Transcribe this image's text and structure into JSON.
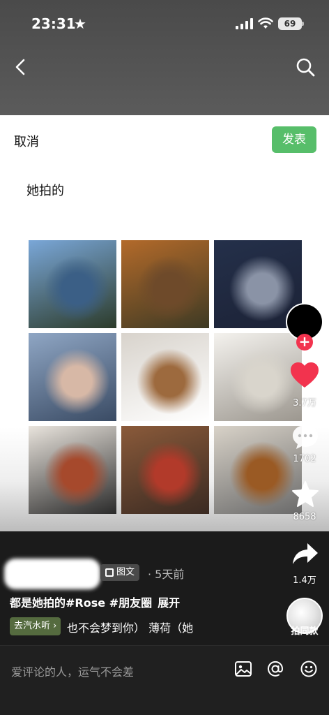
{
  "status_bar": {
    "time": "23:31",
    "battery": "69"
  },
  "editor": {
    "cancel_label": "取消",
    "publish_label": "发表",
    "post_text": "她拍的"
  },
  "photos": [
    {
      "name": "photo-ocean-view",
      "colors": [
        "#7aa7d8",
        "#3b5f86",
        "#2c3b2a"
      ]
    },
    {
      "name": "photo-autumn-path",
      "colors": [
        "#b36a2a",
        "#6e4a2a",
        "#3e3a24"
      ]
    },
    {
      "name": "photo-cloudy-sky",
      "colors": [
        "#24304a",
        "#8a93a6",
        "#1c2236"
      ]
    },
    {
      "name": "photo-hand-ring",
      "colors": [
        "#8fa6c4",
        "#d7b8a6",
        "#3a4b64"
      ]
    },
    {
      "name": "photo-puppy",
      "colors": [
        "#d8d3cc",
        "#9d6a3e",
        "#ffffff"
      ]
    },
    {
      "name": "photo-roses-card",
      "colors": [
        "#f4f2ee",
        "#d9d5cc",
        "#9c978f"
      ]
    },
    {
      "name": "photo-pastry-paper",
      "colors": [
        "#e9e4dd",
        "#a6492c",
        "#2a2a2a"
      ]
    },
    {
      "name": "photo-dinner-table",
      "colors": [
        "#8a5a3a",
        "#b23a2a",
        "#3a2a22"
      ]
    },
    {
      "name": "photo-french-toast",
      "colors": [
        "#d8d2c8",
        "#9a5a24",
        "#6a6a6a"
      ]
    }
  ],
  "rail": {
    "like_count": "3.7万",
    "comment_count": "1702",
    "favorite_count": "8658",
    "share_count": "1.4万",
    "same_label": "拍同款",
    "colors": {
      "like": "#f2334e",
      "follow": "#f2334e"
    }
  },
  "post_info": {
    "type_label": "图文",
    "time": "· 5天前",
    "caption": "都是她拍的#Rose #朋友圈",
    "expand_label": "展开",
    "music_chip": "去汽水听 ›",
    "music_text": "也不会梦到你）  薄荷（她"
  },
  "comment_bar": {
    "placeholder": "爱评论的人，运气不会差"
  }
}
